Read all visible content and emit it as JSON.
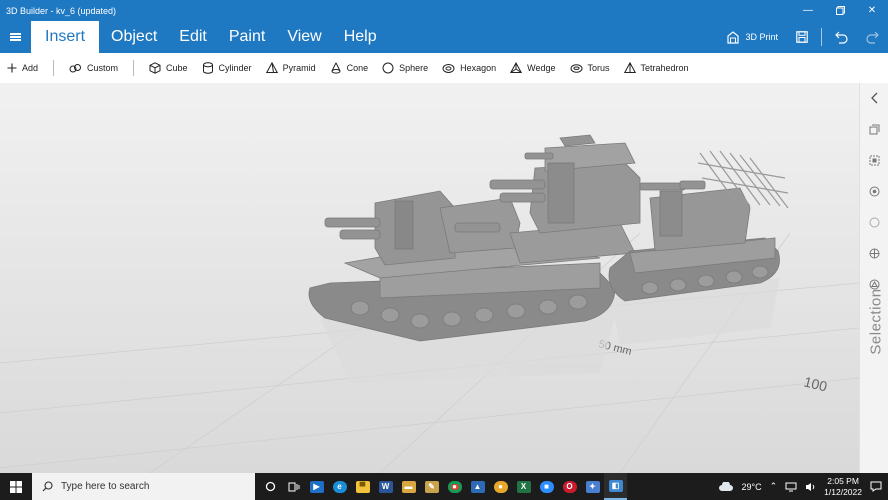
{
  "window": {
    "title": "3D Builder - kv_6 (updated)"
  },
  "menu": {
    "tabs": [
      {
        "label": "Insert",
        "active": true
      },
      {
        "label": "Object"
      },
      {
        "label": "Edit"
      },
      {
        "label": "Paint"
      },
      {
        "label": "View"
      },
      {
        "label": "Help"
      }
    ],
    "print_label": "3D Print"
  },
  "toolbar": {
    "add_label": "Add",
    "custom_label": "Custom",
    "shapes": [
      "Cube",
      "Cylinder",
      "Pyramid",
      "Cone",
      "Sphere",
      "Hexagon",
      "Wedge",
      "Torus",
      "Tetrahedron"
    ]
  },
  "viewport": {
    "ruler_labels": [
      "50 mm",
      "100"
    ]
  },
  "right_panel": {
    "label": "Selection",
    "icons": [
      "chevron-left-icon",
      "duplicate-icon",
      "group-icon",
      "settings-icon",
      "circle-icon",
      "target-icon",
      "triangle-icon"
    ]
  },
  "taskbar": {
    "search_placeholder": "Type here to search",
    "weather": "29°C",
    "time": "2:05 PM",
    "date": "1/12/2022"
  },
  "colors": {
    "accent": "#1e78c2",
    "viewport_bg": "#e6e6e6",
    "model": "#8f8f8f"
  }
}
